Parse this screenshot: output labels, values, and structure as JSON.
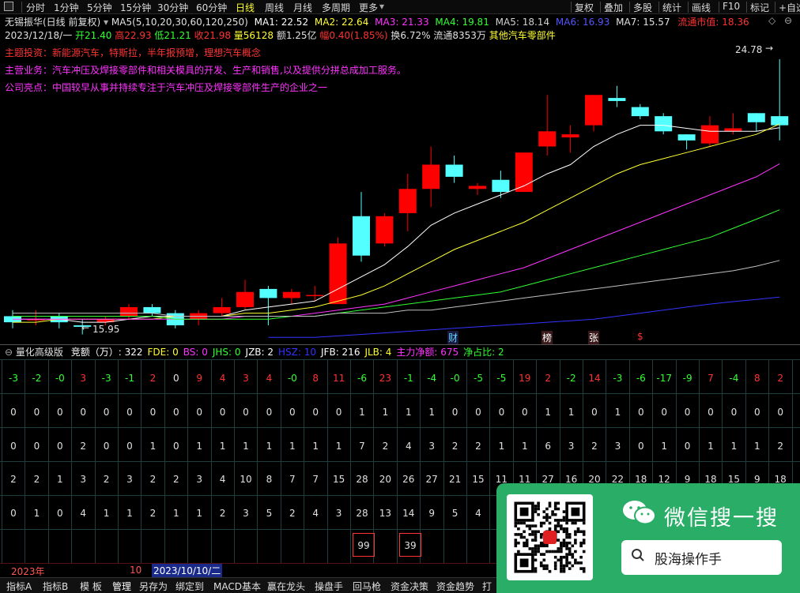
{
  "toolbar": {
    "items": [
      "分时",
      "1分钟",
      "5分钟",
      "15分钟",
      "30分钟",
      "60分钟",
      "日线",
      "周线",
      "月线",
      "多周期",
      "更多"
    ],
    "active": "日线",
    "right_items": [
      "复权",
      "叠加",
      "多股",
      "统计",
      "画线",
      "F10",
      "标记",
      "+自选"
    ]
  },
  "stock": {
    "name": "无锡振华(日线 前复权)",
    "ma_params": "MA5(5,10,20,30,60,120,250)",
    "ma1": "MA1: 22.52",
    "ma2": "MA2: 22.64",
    "ma3": "MA3: 21.33",
    "ma4": "MA4: 19.81",
    "ma5": "MA5: 18.14",
    "ma6": "MA6: 16.93",
    "ma7": "MA7: 15.57",
    "market_cap": "流通市值: 18.36",
    "date": "2023/12/18/一",
    "open": "开21.40",
    "high": "高22.93",
    "low": "低21.21",
    "close": "收21.98",
    "volume": "量56128",
    "amount": "额1.25亿",
    "change": "幅0.40(1.85%)",
    "turnover": "换6.72%",
    "float_shares": "流通8353万",
    "sector": "其他汽车零部件"
  },
  "info": {
    "theme": "主题投资：新能源汽车，特斯拉，半年报预增，理想汽车概念",
    "business": "主营业务：汽车冲压及焊接零部件和相关模具的开发、生产和销售,以及提供分拼总成加工服务。",
    "highlight": "公司亮点：中国较早从事并持续专注于汽车冲压及焊接零部件生产的企业之一"
  },
  "price_labels": {
    "high": "24.78",
    "low": "15.95"
  },
  "markers": [
    "财",
    "榜",
    "张",
    "$"
  ],
  "chart_data": {
    "type": "candlestick",
    "candles": [
      {
        "o": 16.3,
        "c": 16.1,
        "h": 16.5,
        "l": 15.9
      },
      {
        "o": 16.2,
        "c": 16.2,
        "h": 16.5,
        "l": 16.0
      },
      {
        "o": 16.3,
        "c": 16.1,
        "h": 16.4,
        "l": 15.9
      },
      {
        "o": 16.0,
        "c": 15.95,
        "h": 16.2,
        "l": 15.7
      },
      {
        "o": 16.1,
        "c": 16.2,
        "h": 16.3,
        "l": 16.0
      },
      {
        "o": 16.3,
        "c": 16.6,
        "h": 16.7,
        "l": 16.2
      },
      {
        "o": 16.6,
        "c": 16.4,
        "h": 16.7,
        "l": 16.3
      },
      {
        "o": 16.4,
        "c": 16.0,
        "h": 16.5,
        "l": 15.9
      },
      {
        "o": 16.2,
        "c": 16.4,
        "h": 16.5,
        "l": 16.0
      },
      {
        "o": 16.4,
        "c": 16.6,
        "h": 16.9,
        "l": 16.3
      },
      {
        "o": 16.6,
        "c": 17.1,
        "h": 17.5,
        "l": 16.5
      },
      {
        "o": 17.2,
        "c": 16.9,
        "h": 17.3,
        "l": 16.0
      },
      {
        "o": 16.9,
        "c": 17.1,
        "h": 17.2,
        "l": 16.7
      },
      {
        "o": 17.0,
        "c": 17.0,
        "h": 17.3,
        "l": 16.8
      },
      {
        "o": 16.7,
        "c": 18.7,
        "h": 18.9,
        "l": 16.7
      },
      {
        "o": 19.6,
        "c": 18.3,
        "h": 20.4,
        "l": 18.1
      },
      {
        "o": 18.7,
        "c": 19.6,
        "h": 19.7,
        "l": 18.6
      },
      {
        "o": 19.7,
        "c": 20.5,
        "h": 21.0,
        "l": 19.1
      },
      {
        "o": 20.5,
        "c": 21.3,
        "h": 21.9,
        "l": 19.9
      },
      {
        "o": 21.3,
        "c": 20.9,
        "h": 21.6,
        "l": 20.7
      },
      {
        "o": 20.5,
        "c": 20.6,
        "h": 20.7,
        "l": 20.3
      },
      {
        "o": 20.8,
        "c": 20.4,
        "h": 21.1,
        "l": 20.2
      },
      {
        "o": 20.4,
        "c": 21.7,
        "h": 21.7,
        "l": 20.4
      },
      {
        "o": 21.9,
        "c": 22.4,
        "h": 23.6,
        "l": 21.6
      },
      {
        "o": 22.2,
        "c": 22.3,
        "h": 22.6,
        "l": 21.7
      },
      {
        "o": 22.6,
        "c": 23.6,
        "h": 23.6,
        "l": 22.4
      },
      {
        "o": 23.5,
        "c": 23.4,
        "h": 23.9,
        "l": 23.2
      },
      {
        "o": 23.2,
        "c": 22.9,
        "h": 23.3,
        "l": 22.8
      },
      {
        "o": 22.9,
        "c": 22.4,
        "h": 23.0,
        "l": 22.3
      },
      {
        "o": 22.3,
        "c": 22.1,
        "h": 22.3,
        "l": 21.8
      },
      {
        "o": 22.0,
        "c": 22.6,
        "h": 22.9,
        "l": 21.9
      },
      {
        "o": 22.4,
        "c": 22.5,
        "h": 23.0,
        "l": 22.3
      },
      {
        "o": 23.0,
        "c": 22.7,
        "h": 23.0,
        "l": 22.4
      },
      {
        "o": 22.9,
        "c": 22.6,
        "h": 24.78,
        "l": 22.1
      }
    ],
    "ma_lines": [
      {
        "name": "MA1",
        "color": "#ffffff",
        "values": [
          16.2,
          16.2,
          16.2,
          16.1,
          16.1,
          16.2,
          16.3,
          16.3,
          16.3,
          16.3,
          16.5,
          16.6,
          16.7,
          16.8,
          17.2,
          17.6,
          18.0,
          18.6,
          19.3,
          19.7,
          20.0,
          20.3,
          20.6,
          21.0,
          21.3,
          21.9,
          22.3,
          22.6,
          22.6,
          22.5,
          22.4,
          22.4,
          22.4,
          22.52
        ]
      },
      {
        "name": "MA2",
        "color": "#ffff33",
        "values": [
          16.1,
          16.1,
          16.2,
          16.2,
          16.2,
          16.2,
          16.2,
          16.3,
          16.3,
          16.3,
          16.4,
          16.4,
          16.5,
          16.6,
          16.8,
          17.0,
          17.3,
          17.7,
          18.1,
          18.5,
          18.8,
          19.1,
          19.4,
          19.8,
          20.2,
          20.6,
          21.0,
          21.3,
          21.5,
          21.7,
          21.9,
          22.1,
          22.3,
          22.64
        ]
      },
      {
        "name": "MA3",
        "color": "#ff33ff",
        "values": [
          16.2,
          16.2,
          16.2,
          16.2,
          16.2,
          16.2,
          16.2,
          16.2,
          16.2,
          16.2,
          16.3,
          16.3,
          16.3,
          16.4,
          16.5,
          16.6,
          16.7,
          16.9,
          17.1,
          17.3,
          17.5,
          17.7,
          17.9,
          18.2,
          18.5,
          18.8,
          19.1,
          19.4,
          19.7,
          20.0,
          20.3,
          20.6,
          20.9,
          21.33
        ]
      },
      {
        "name": "MA4",
        "color": "#33ff33",
        "values": [
          16.3,
          16.3,
          16.3,
          16.3,
          16.3,
          16.3,
          16.3,
          16.2,
          16.2,
          16.2,
          16.2,
          16.2,
          16.3,
          16.3,
          16.4,
          16.5,
          16.6,
          16.7,
          16.8,
          16.9,
          17.0,
          17.1,
          17.3,
          17.5,
          17.7,
          17.9,
          18.1,
          18.3,
          18.5,
          18.7,
          18.9,
          19.2,
          19.5,
          19.81
        ]
      },
      {
        "name": "MA5",
        "color": "#c0c0c0",
        "values": [
          16.4,
          16.4,
          16.4,
          16.4,
          16.4,
          16.4,
          16.4,
          16.3,
          16.3,
          16.3,
          16.3,
          16.3,
          16.3,
          16.3,
          16.4,
          16.4,
          16.4,
          16.5,
          16.5,
          16.6,
          16.7,
          16.8,
          16.9,
          17.0,
          17.1,
          17.2,
          17.3,
          17.4,
          17.5,
          17.6,
          17.7,
          17.8,
          17.95,
          18.14
        ]
      },
      {
        "name": "MA6",
        "color": "#3333ff",
        "values": [
          null,
          null,
          null,
          null,
          null,
          null,
          null,
          null,
          null,
          null,
          null,
          15.6,
          15.6,
          15.6,
          15.65,
          15.7,
          15.75,
          15.8,
          15.85,
          15.9,
          15.95,
          16.0,
          16.05,
          16.1,
          16.15,
          16.2,
          16.3,
          16.4,
          16.5,
          16.6,
          16.7,
          16.78,
          16.85,
          16.93
        ]
      }
    ],
    "ylim": [
      15.4,
      25.3
    ]
  },
  "indicator": {
    "title": "量化高级版",
    "fields": [
      {
        "label": "竞额（万）: 322",
        "color": "#ffffff"
      },
      {
        "label": "FDE: 0",
        "color": "#ffff33"
      },
      {
        "label": "BS: 0",
        "color": "#ff33ff"
      },
      {
        "label": "JHS: 0",
        "color": "#33ff33"
      },
      {
        "label": "JZB: 2",
        "color": "#ffffff"
      },
      {
        "label": "HSZ: 10",
        "color": "#3333ff"
      },
      {
        "label": "JFB: 216",
        "color": "#ffffff"
      },
      {
        "label": "JLB: 4",
        "color": "#ffff33"
      },
      {
        "label": "主力净额: 675",
        "color": "#ff33ff"
      },
      {
        "label": "净占比: 2",
        "color": "#33ff33"
      }
    ],
    "rows": [
      [
        "-3",
        "-2",
        "-0",
        "3",
        "-3",
        "-1",
        "2",
        "0",
        "9",
        "4",
        "3",
        "4",
        "-0",
        "8",
        "11",
        "-6",
        "23",
        "-1",
        "-4",
        "-0",
        "-5",
        "-5",
        "19",
        "2",
        "-2",
        "14",
        "-3",
        "-6",
        "-17",
        "-9",
        "7",
        "-4",
        "8",
        "2"
      ],
      [
        "0",
        "0",
        "0",
        "0",
        "0",
        "0",
        "0",
        "0",
        "0",
        "0",
        "0",
        "0",
        "0",
        "0",
        "0",
        "1",
        "1",
        "1",
        "1",
        "0",
        "0",
        "0",
        "0",
        "1",
        "1",
        "0",
        "1",
        "0",
        "0",
        "0",
        "0",
        "0",
        "0",
        "0"
      ],
      [
        "0",
        "0",
        "0",
        "2",
        "0",
        "0",
        "1",
        "0",
        "1",
        "1",
        "1",
        "1",
        "1",
        "1",
        "1",
        "7",
        "2",
        "4",
        "3",
        "2",
        "2",
        "1",
        "1",
        "6",
        "3",
        "2",
        "3",
        "0",
        "1",
        "0",
        "1",
        "1",
        "1",
        "2"
      ],
      [
        "2",
        "2",
        "1",
        "3",
        "2",
        "3",
        "2",
        "2",
        "3",
        "4",
        "10",
        "8",
        "7",
        "7",
        "15",
        "28",
        "20",
        "26",
        "27",
        "21",
        "15",
        "11",
        "11",
        "27",
        "16",
        "20",
        "22",
        "18",
        "12",
        "9",
        "18",
        "15",
        "9",
        "18"
      ],
      [
        "0",
        "1",
        "0",
        "4",
        "1",
        "1",
        "2",
        "1",
        "1",
        "2",
        "3",
        "5",
        "2",
        "4",
        "3",
        "28",
        "13",
        "14",
        "9",
        "5",
        "4",
        "",
        "",
        "",
        "",
        "",
        "",
        "",
        "",
        "",
        "",
        "",
        "",
        ""
      ]
    ],
    "boxed": [
      "99",
      "39"
    ]
  },
  "datebar": {
    "year": "2023年",
    "mid": "10",
    "date": "2023/10/10/二"
  },
  "tabs": [
    "指标A",
    "指标B",
    "模 板",
    "管理",
    "另存为",
    "绑定到",
    "MACD基本",
    "赢在龙头",
    "操盘手",
    "回马枪",
    "资金决策",
    "资金趋势",
    "打"
  ],
  "wechat": {
    "title": "微信搜一搜",
    "search_text": "股海操作手"
  },
  "colors": {
    "up": "#ff0000",
    "down": "#54ffff",
    "bg": "#000000",
    "accent": "#2aae67"
  }
}
